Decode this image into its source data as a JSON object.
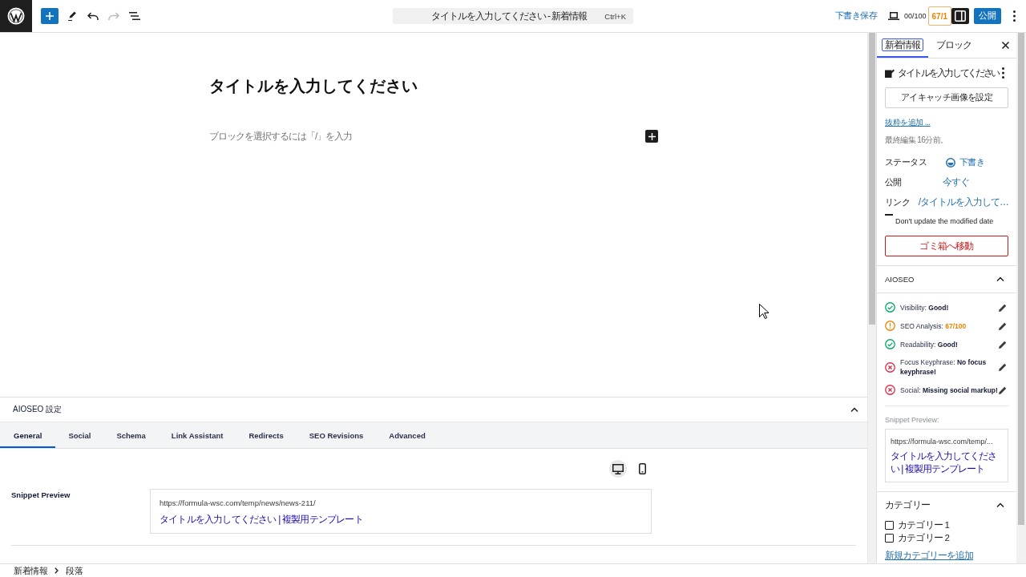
{
  "topbar": {
    "undo": {
      "disabled": false
    },
    "redo": {
      "disabled": true
    },
    "command": {
      "text": "タイトルを入力してください - 新着情報",
      "shortcut": "Ctrl+K"
    },
    "save_draft": "下書き保存",
    "counter": "00/100",
    "score": "67/1",
    "settings": {
      "on": true
    },
    "publish": "公開"
  },
  "editor": {
    "title": "タイトルを入力してください",
    "placeholder": "ブロックを選択するには「/」を入力"
  },
  "aioseo_settings": {
    "title": "AIOSEO 設定",
    "expanded": true,
    "tabs": [
      {
        "label": "General",
        "selected": true
      },
      {
        "label": "Social",
        "selected": false
      },
      {
        "label": "Schema",
        "selected": false
      },
      {
        "label": "Link Assistant",
        "selected": false
      },
      {
        "label": "Redirects",
        "selected": false
      },
      {
        "label": "SEO Revisions",
        "selected": false
      },
      {
        "label": "Advanced",
        "selected": false
      }
    ],
    "preview_modes": [
      {
        "kind": "desktop",
        "selected": true
      },
      {
        "kind": "mobile",
        "selected": false
      }
    ],
    "snippet_preview": {
      "label": "Snippet Preview",
      "url": "https://formula-wsc.com/temp/news/news-211/",
      "title": "タイトルを入力してください | 複製用テンプレート"
    }
  },
  "breadcrumb": [
    "新着情報",
    "段落"
  ],
  "sidebar": {
    "tabs": [
      {
        "label": "新着情報",
        "selected": true
      },
      {
        "label": "ブロック",
        "selected": false
      }
    ],
    "post": {
      "title": "タイトルを入力してください",
      "featured_image_button": "アイキャッチ画像を設定",
      "excerpt_link": "抜粋を追加 ...",
      "last_edited": "最終編集 16分前。",
      "fields": [
        {
          "kind": "status",
          "label": "ステータス",
          "value": "下書き"
        },
        {
          "kind": "plain",
          "label": "公開",
          "value": "今すぐ"
        },
        {
          "kind": "plain",
          "label": "リンク",
          "value": "/タイトルを入力して…"
        }
      ],
      "modified_date_option": "Don't update the modified date",
      "trash_button": "ゴミ箱へ移動"
    },
    "aioseo": {
      "title": "AIOSEO",
      "expanded": true,
      "checks": [
        {
          "kind": "good",
          "text": "Visibility: **Good!**"
        },
        {
          "kind": "warning",
          "text": "SEO Analysis: **67/100**"
        },
        {
          "kind": "good",
          "text": "Readability: **Good!**"
        },
        {
          "kind": "error",
          "text": "Focus Keyphrase: **No focus keyphrase!**"
        },
        {
          "kind": "error",
          "text": "Social: **Missing social markup!**"
        }
      ],
      "snippet_label": "Snippet Preview:",
      "snippet_url": "https://formula-wsc.com/temp/...",
      "snippet_title": "タイトルを入力してください | 複製用テンプレート"
    },
    "categories": {
      "title": "カテゴリー",
      "expanded": true,
      "items": [
        {
          "label": "カテゴリー 1",
          "checked": false
        },
        {
          "label": "カテゴリー 2",
          "checked": false
        }
      ],
      "add_link": "新規カテゴリーを追加"
    }
  }
}
